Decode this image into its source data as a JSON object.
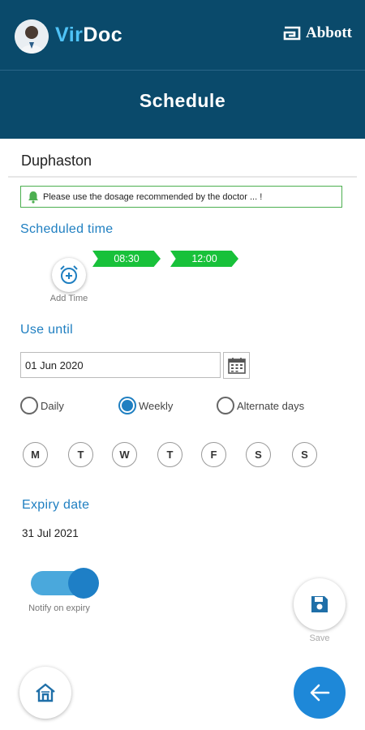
{
  "header": {
    "brand_prefix": "Vir",
    "brand_suffix": "Doc",
    "partner_logo": "Abbott",
    "title": "Schedule"
  },
  "medicine": {
    "name": "Duphaston",
    "notice": "Please use the dosage recommended by the doctor ... !"
  },
  "scheduled_time": {
    "label": "Scheduled time",
    "times": [
      "08:30",
      "12:00"
    ],
    "add_label": "Add Time"
  },
  "use_until": {
    "label": "Use until",
    "date": "01 Jun 2020"
  },
  "frequency": {
    "options": [
      "Daily",
      "Weekly",
      "Alternate days"
    ],
    "selected": "Weekly"
  },
  "days": [
    "M",
    "T",
    "W",
    "T",
    "F",
    "S",
    "S"
  ],
  "expiry": {
    "label": "Expiry date",
    "date": "31 Jul 2021"
  },
  "notify": {
    "label": "Notify on expiry",
    "enabled": true
  },
  "actions": {
    "save_label": "Save"
  },
  "colors": {
    "header_bg": "#0a4a6b",
    "accent": "#1f7fc1",
    "time_chip": "#18c13a",
    "notice_border": "#4caf50",
    "back_button": "#1e88d8"
  }
}
